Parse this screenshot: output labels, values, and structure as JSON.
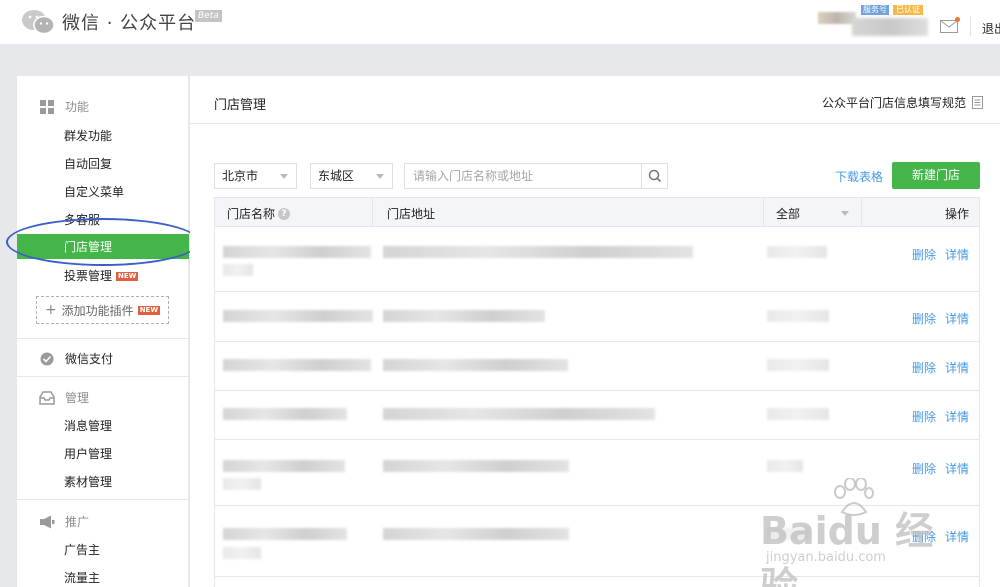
{
  "header": {
    "brand": "微信 · 公众平台",
    "beta": "Beta",
    "tag_blue": "服务号",
    "tag_verified": "已认证",
    "logout": "退出"
  },
  "sidebar": {
    "sections": [
      {
        "title": "功能",
        "icon": "grid-icon",
        "items": [
          "群发功能",
          "自动回复",
          "自定义菜单",
          "多客服",
          "门店管理",
          "投票管理"
        ]
      },
      {
        "title": "微信支付",
        "icon": "check-circle-icon",
        "items": []
      },
      {
        "title": "管理",
        "icon": "inbox-icon",
        "items": [
          "消息管理",
          "用户管理",
          "素材管理"
        ]
      },
      {
        "title": "推广",
        "icon": "megaphone-icon",
        "items": [
          "广告主",
          "流量主"
        ]
      }
    ],
    "active_item": "门店管理",
    "new_badge": "NEW",
    "add_plugin": "添加功能插件"
  },
  "content": {
    "title": "门店管理",
    "spec_link": "公众平台门店信息填写规范",
    "filters": {
      "city": "北京市",
      "district": "东城区",
      "search_placeholder": "请输入门店名称或地址"
    },
    "download": "下载表格",
    "new_store": "新建门店",
    "table": {
      "columns": [
        "门店名称",
        "门店地址",
        "全部",
        "操作"
      ],
      "row_actions": {
        "delete": "删除",
        "detail": "详情"
      },
      "row_count": 6
    }
  },
  "watermark": {
    "brand": "Baidu 经验",
    "url": "jingyan.baidu.com"
  },
  "colors": {
    "accent_green": "#44b549",
    "link_blue": "#459ae9",
    "annotation_circle": "#3b5fc8"
  }
}
